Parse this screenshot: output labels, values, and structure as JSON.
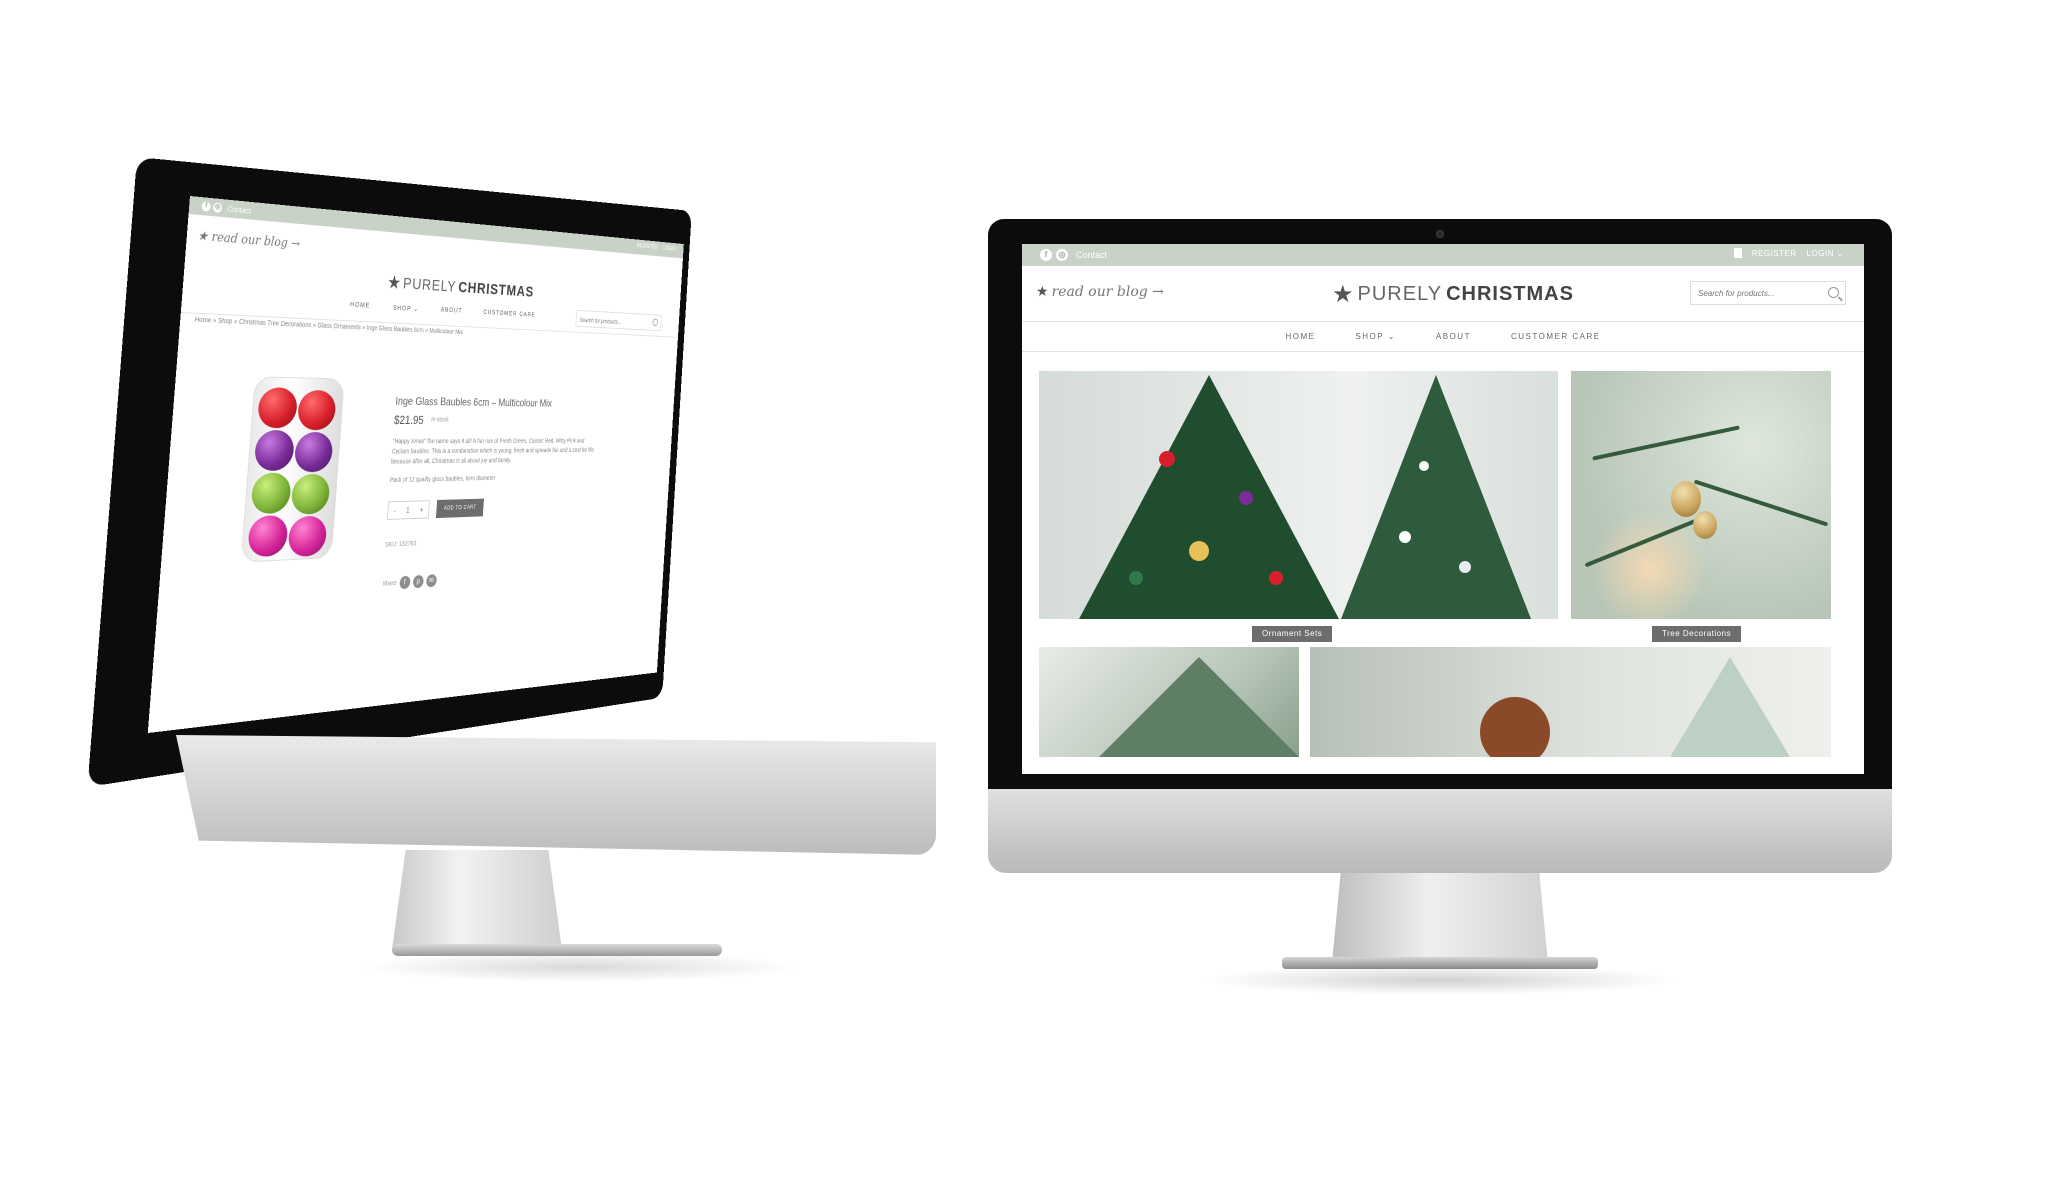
{
  "site": {
    "logo_word_light": "PURELY",
    "logo_word_bold": "CHRISTMAS",
    "blog_link": "read our blog",
    "contact": "Contact",
    "register": "REGISTER",
    "login": "LOGIN",
    "search_placeholder": "Search for products...",
    "nav": [
      "HOME",
      "SHOP",
      "ABOUT",
      "CUSTOMER CARE"
    ]
  },
  "homepage": {
    "tiles": [
      "Ornament Sets",
      "Tree Decorations"
    ]
  },
  "product_page": {
    "breadcrumb": "Home » Shop » Christmas Tree Decorations » Glass Ornaments » Inge Glass Baubles 6cm » Multicolour Mix",
    "title": "Inge Glass Baubles 6cm – Multicolour Mix",
    "price": "$21.95",
    "stock": "In stock",
    "description": "\"Happy Xmas\" the name says it all! A fun mix of Fresh Green, Classic Red, Witty Pink and Cyclam baubles. This is a combination which is young, fresh and spreads fun and a zest for life because after all, Christmas is all about joy and family.",
    "pack_note": "Pack of 12 quality glass baubles, 6cm diameter",
    "quantity": "1",
    "add_to_cart": "ADD TO CART",
    "sku": "SKU: 152763",
    "share_label": "Share"
  },
  "colors": {
    "topbar": "#c8d2c6",
    "label_bg": "#6d6d6d",
    "bauble_red": "#d8202c",
    "bauble_purple": "#7a2c9a",
    "bauble_green": "#7fb43a",
    "bauble_pink": "#d6259a"
  }
}
